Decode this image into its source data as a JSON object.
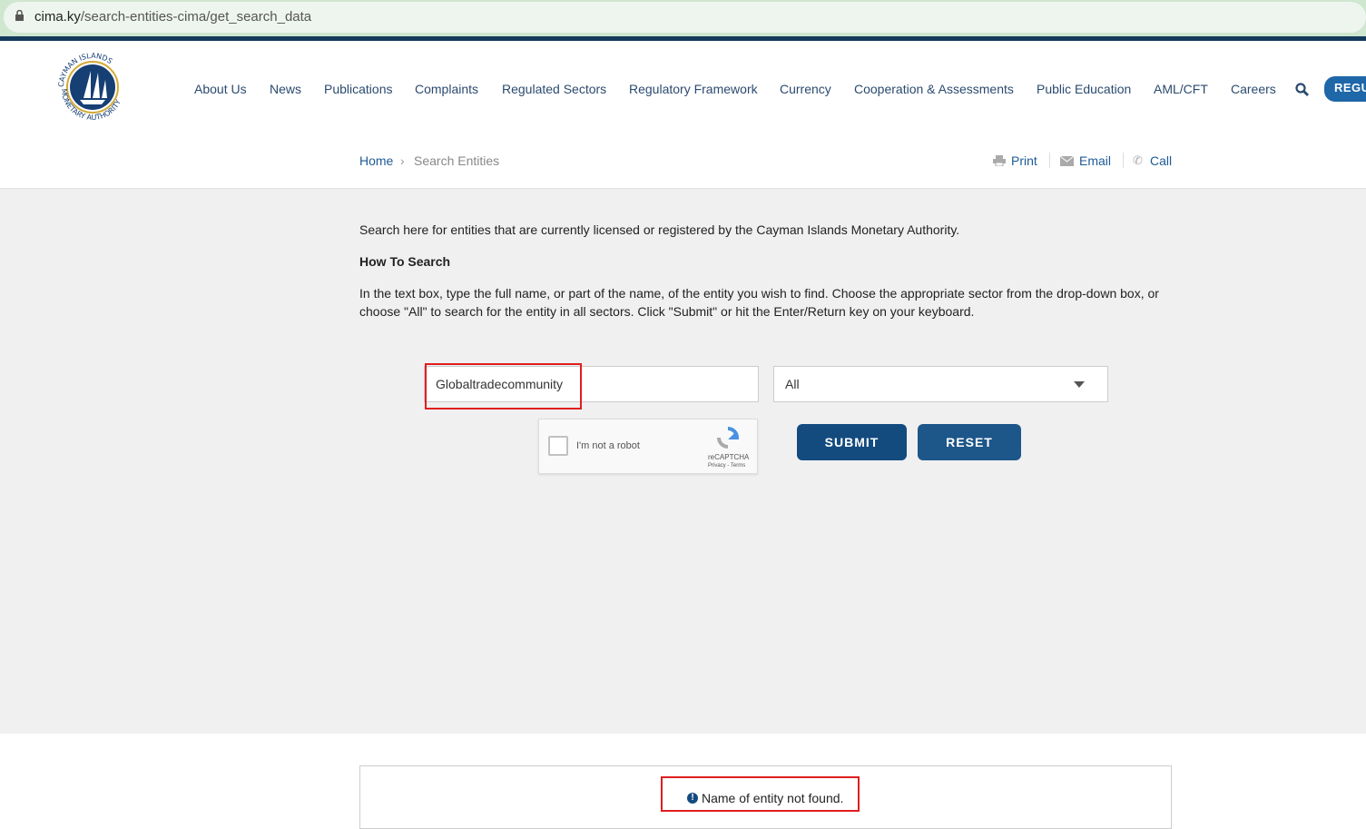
{
  "browser": {
    "url_host": "cima.ky",
    "url_path": "/search-entities-cima/get_search_data"
  },
  "header": {
    "logo_text": "Cayman Islands Monetary Authority",
    "nav": [
      "About Us",
      "News",
      "Publications",
      "Complaints",
      "Regulated Sectors",
      "Regulatory Framework",
      "Currency",
      "Cooperation & Assessments",
      "Public Education",
      "AML/CFT",
      "Careers"
    ],
    "cta": "REGU"
  },
  "breadcrumb": {
    "home": "Home",
    "current": "Search Entities"
  },
  "utility": {
    "print": "Print",
    "email": "Email",
    "call": "Call"
  },
  "content": {
    "intro": "Search here for entities that are currently licensed or registered by the Cayman Islands Monetary Authority.",
    "how_title": "How To Search",
    "how_text": "In the text box, type the full name, or part of the name, of the entity you wish to find. Choose the appropriate sector from the drop-down box, or choose \"All\" to search for the entity in all sectors. Click \"Submit\" or hit the Enter/Return key on your keyboard."
  },
  "form": {
    "search_value": "Globaltradecommunity",
    "sector": "All",
    "captcha_label": "I'm not a robot",
    "captcha_brand": "reCAPTCHA",
    "captcha_links": "Privacy - Terms",
    "submit": "SUBMIT",
    "reset": "RESET"
  },
  "result": {
    "message": "Name of entity not found."
  },
  "colors": {
    "primary": "#134b7f",
    "accent": "#1e67a8",
    "highlight": "#e01e1e"
  }
}
